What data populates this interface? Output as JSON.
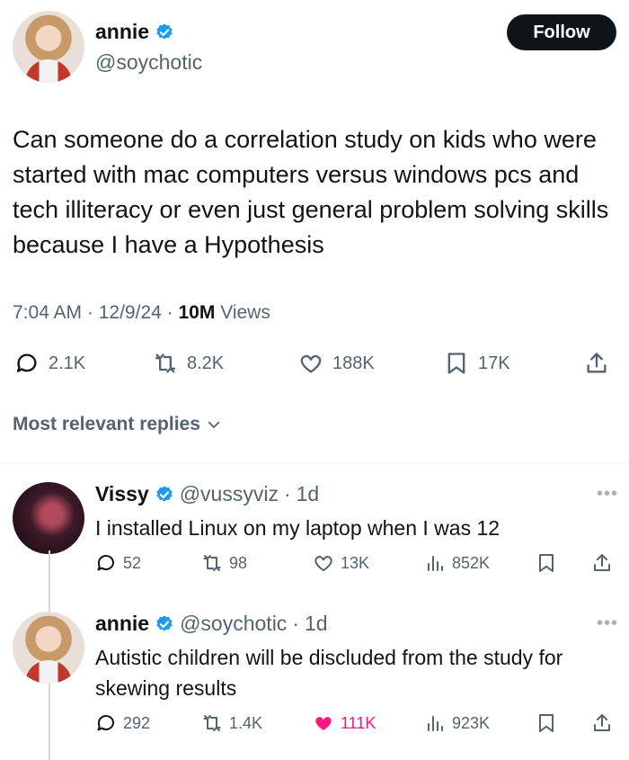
{
  "tweet": {
    "author_name": "annie",
    "author_handle": "@soychotic",
    "follow_label": "Follow",
    "text": "Can someone do a correlation study on kids who were started with mac computers versus windows pcs and tech illiteracy or even just general problem solving skills because I have a Hypothesis",
    "time": "7:04 AM",
    "date": "12/9/24",
    "views_count": "10M",
    "views_label": "Views",
    "replies": "2.1K",
    "reposts": "8.2K",
    "likes": "188K",
    "bookmarks": "17K"
  },
  "replies_sort_label": "Most relevant replies",
  "replies": [
    {
      "name": "Vissy",
      "handle": "@vussyviz",
      "age": "1d",
      "text": "I installed Linux on my laptop when I was 12",
      "replies": "52",
      "reposts": "98",
      "likes": "13K",
      "views": "852K",
      "liked": false
    },
    {
      "name": "annie",
      "handle": "@soychotic",
      "age": "1d",
      "text": "Autistic children will be discluded from the study for skewing results",
      "replies": "292",
      "reposts": "1.4K",
      "likes": "111K",
      "views": "923K",
      "liked": true
    }
  ],
  "colors": {
    "verified": "#1d9bf0",
    "like_active": "#f91880",
    "secondary_text": "#536471"
  },
  "icons": {
    "reply": "speech-bubble-icon",
    "repost": "repost-arrows-icon",
    "like": "heart-icon",
    "bookmark": "bookmark-icon",
    "share": "share-upload-icon",
    "views": "bar-chart-icon",
    "more": "ellipsis-icon",
    "sort": "chevron-down-icon",
    "verified": "verified-badge-icon"
  }
}
